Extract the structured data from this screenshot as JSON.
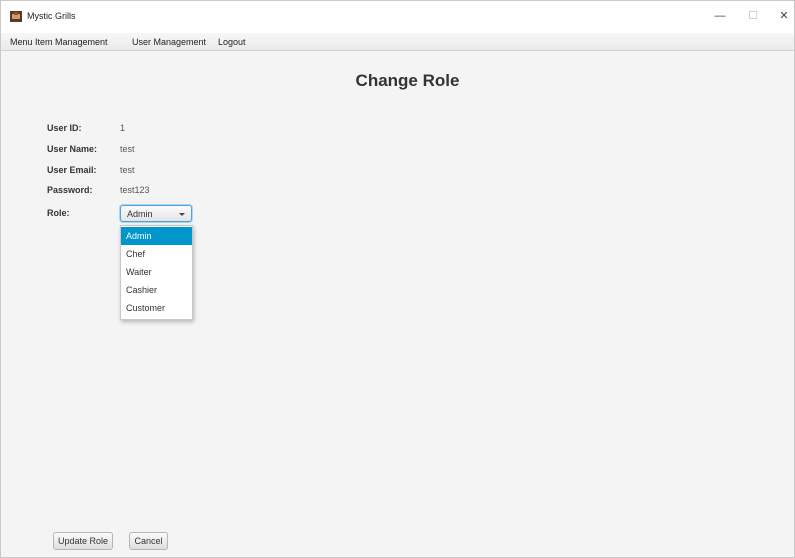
{
  "window": {
    "title": "Mystic Grills",
    "controls": {
      "minimize": "—",
      "maximize": "☐",
      "close": "✕"
    }
  },
  "menubar": {
    "items": [
      "Menu Item Management",
      "User Management",
      "Logout"
    ]
  },
  "page": {
    "title": "Change Role"
  },
  "form": {
    "fields": [
      {
        "label": "User ID:",
        "value": "1"
      },
      {
        "label": "User Name:",
        "value": "test"
      },
      {
        "label": "User Email:",
        "value": "test"
      },
      {
        "label": "Password:",
        "value": "test123"
      }
    ],
    "role": {
      "label": "Role:",
      "selected": "Admin",
      "options": [
        "Admin",
        "Chef",
        "Waiter",
        "Cashier",
        "Customer"
      ]
    }
  },
  "buttons": {
    "update": "Update Role",
    "cancel": "Cancel"
  },
  "colors": {
    "selection": "#0096c9",
    "focus_border": "#4fa3d6",
    "background": "#f4f4f4"
  }
}
